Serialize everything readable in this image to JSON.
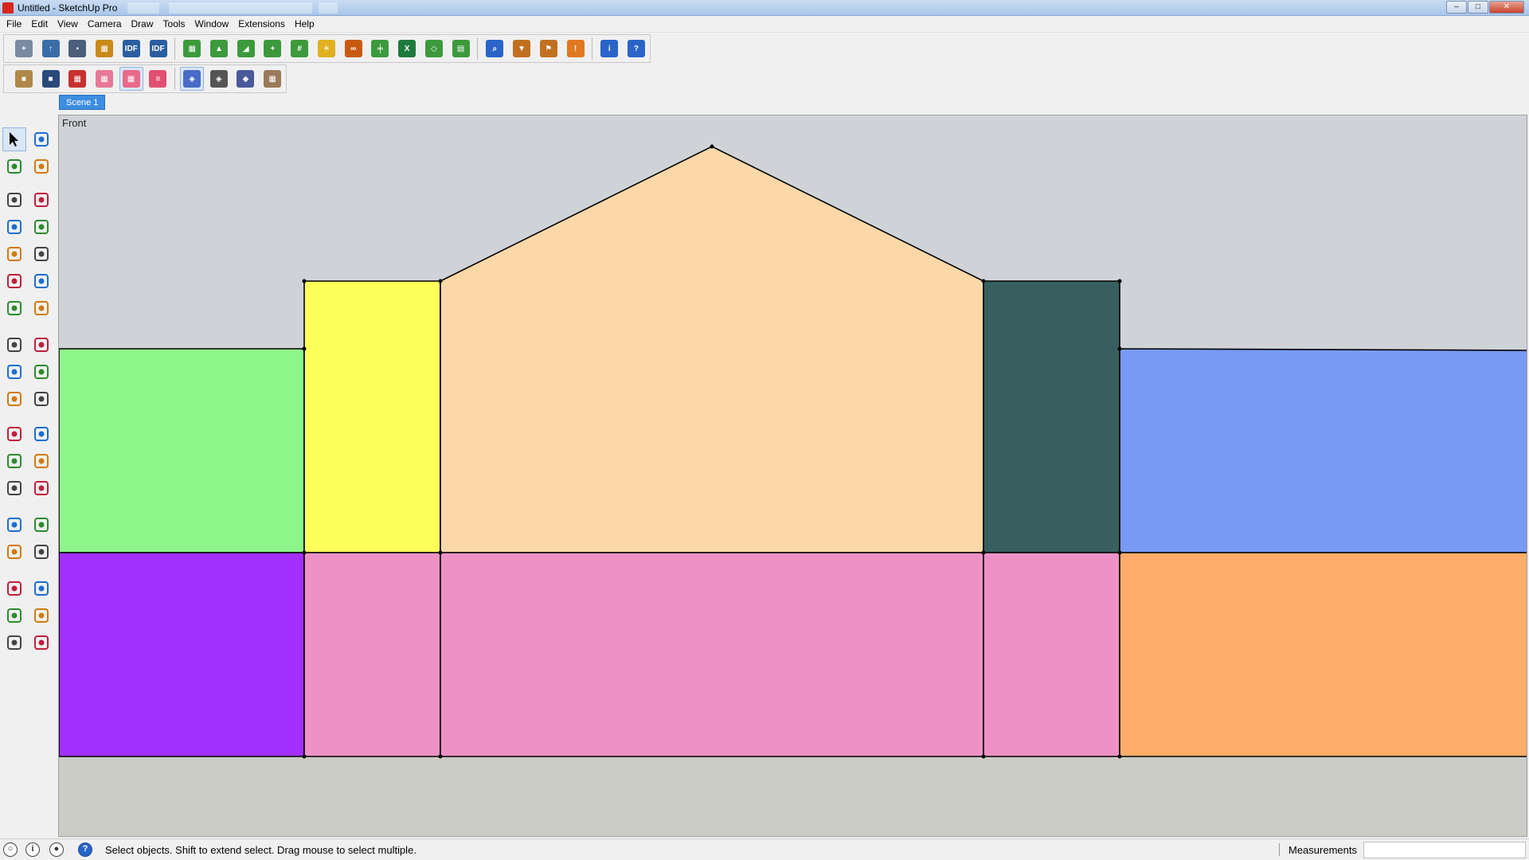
{
  "window": {
    "title": "Untitled - SketchUp Pro",
    "controls": {
      "minimize": "–",
      "maximize": "□",
      "close": "✕"
    }
  },
  "menu": [
    "File",
    "Edit",
    "View",
    "Camera",
    "Draw",
    "Tools",
    "Window",
    "Extensions",
    "Help"
  ],
  "toolbar1": [
    {
      "name": "new-model-icon",
      "color": "#7a8aa0",
      "glyph": "+"
    },
    {
      "name": "open-file-icon",
      "color": "#3a6ea8",
      "glyph": "↑"
    },
    {
      "name": "save-icon",
      "color": "#4b5e7a",
      "glyph": "▪"
    },
    {
      "name": "components-icon",
      "color": "#c98a1a",
      "glyph": "▦"
    },
    {
      "name": "idf-import-icon",
      "color": "#2a5ea0",
      "glyph": "IDF"
    },
    {
      "name": "idf-export-icon",
      "color": "#2a5ea0",
      "glyph": "IDF"
    },
    {
      "name": "zone-icon",
      "color": "#3c9a3c",
      "glyph": "▦"
    },
    {
      "name": "space-icon",
      "color": "#3c9a3c",
      "glyph": "▲"
    },
    {
      "name": "surface-icon",
      "color": "#3c9a3c",
      "glyph": "◢"
    },
    {
      "name": "add-point-icon",
      "color": "#3c9a3c",
      "glyph": "+"
    },
    {
      "name": "grid-icon",
      "color": "#3c9a3c",
      "glyph": "#"
    },
    {
      "name": "light-bulb-icon",
      "color": "#e0b020",
      "glyph": "☀"
    },
    {
      "name": "glasses-icon",
      "color": "#c85a10",
      "glyph": "∞"
    },
    {
      "name": "pipe-icon",
      "color": "#3c9a3c",
      "glyph": "╪"
    },
    {
      "name": "excel-icon",
      "color": "#1e7a3c",
      "glyph": "X"
    },
    {
      "name": "plane-icon",
      "color": "#3c9a3c",
      "glyph": "◇"
    },
    {
      "name": "tiles-icon",
      "color": "#3c9a3c",
      "glyph": "▤"
    },
    {
      "name": "search-icon",
      "color": "#2a64c8",
      "glyph": "⌕"
    },
    {
      "name": "filter-icon",
      "color": "#c07020",
      "glyph": "▼"
    },
    {
      "name": "pointer-flag-icon",
      "color": "#c07020",
      "glyph": "⚑"
    },
    {
      "name": "warning-icon",
      "color": "#e07820",
      "glyph": "!"
    },
    {
      "name": "info-cube-icon",
      "color": "#2a64c8",
      "glyph": "i"
    },
    {
      "name": "help-cube-icon",
      "color": "#2a64c8",
      "glyph": "?"
    }
  ],
  "toolbar2": [
    {
      "name": "box-icon",
      "color": "#b0884a",
      "glyph": "■"
    },
    {
      "name": "blue-box-icon",
      "color": "#2a4a7a",
      "glyph": "■"
    },
    {
      "name": "red-cubes-icon",
      "color": "#c83030",
      "glyph": "▦"
    },
    {
      "name": "pink-cubes-icon",
      "color": "#e87898",
      "glyph": "▦"
    },
    {
      "name": "pink-stack-icon",
      "color": "#e86a8a",
      "glyph": "▦"
    },
    {
      "name": "layers-icon",
      "color": "#e05070",
      "glyph": "≡"
    },
    {
      "name": "wireframe-cube-icon",
      "color": "#4a6ac8",
      "glyph": "◈"
    },
    {
      "name": "hidden-cube-icon",
      "color": "#555555",
      "glyph": "◈"
    },
    {
      "name": "shaded-cube-icon",
      "color": "#4a5a9a",
      "glyph": "◆"
    },
    {
      "name": "calendar-icon",
      "color": "#9a7a5a",
      "glyph": "▦"
    }
  ],
  "scene_tab": "Scene 1",
  "view_label": "Front",
  "palette": [
    "select-arrow-icon",
    "component-icon",
    "paint-bucket-icon",
    "eraser-icon",
    "pencil-icon",
    "freehand-icon",
    "rectangle-icon",
    "rotated-rectangle-icon",
    "circle-icon",
    "polygon-icon",
    "arc-icon",
    "pie-icon",
    "two-point-arc-icon",
    "three-point-arc-icon",
    "move-icon",
    "push-pull-icon",
    "rotate-icon",
    "follow-me-icon",
    "scale-icon",
    "offset-icon",
    "tape-measure-icon",
    "dimension-icon",
    "protractor-icon",
    "text-icon",
    "axes-icon",
    "3d-text-icon",
    "orbit-icon",
    "pan-icon",
    "zoom-icon",
    "zoom-window-icon",
    "zoom-extents-icon",
    "previous-view-icon",
    "position-camera-icon",
    "look-around-icon",
    "walk-icon",
    "section-plane-icon"
  ],
  "model_colors": {
    "green": "#8ef58a",
    "yellow": "#ffff5a",
    "peach": "#fcd8a8",
    "dark_teal": "#385f5f",
    "blue": "#7899f4",
    "purple": "#a330fe",
    "pink": "#ee92c5",
    "orange": "#feae6a",
    "sky": "#cfd3d7",
    "ground": "#ccccc7"
  },
  "status": {
    "message": "Select objects. Shift to extend select. Drag mouse to select multiple.",
    "measurements_label": "Measurements",
    "measurements_value": ""
  }
}
